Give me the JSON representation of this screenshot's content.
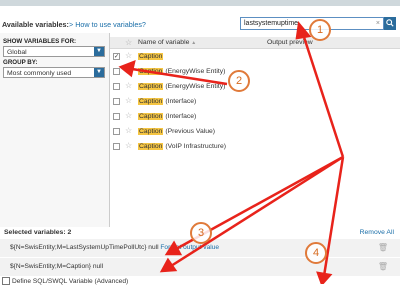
{
  "header": {
    "available_label": "Available variables:",
    "help_link": "> How to use variables?"
  },
  "search": {
    "value": "lastsystemuptime",
    "clear_glyph": "×",
    "button_icon": "search-icon"
  },
  "left_panel": {
    "show_for_label": "SHOW VARIABLES FOR:",
    "show_for_value": "Global",
    "group_by_label": "GROUP BY:",
    "group_by_value": "Most commonly used"
  },
  "table": {
    "col_name": "Name of variable",
    "col_name_sort": "▲",
    "col_preview": "Output preview",
    "rows": [
      {
        "highlight": "Caption",
        "rest": "",
        "checked": true
      },
      {
        "highlight": "Caption",
        "rest": " (EnergyWise Entity)",
        "checked": false
      },
      {
        "highlight": "Caption",
        "rest": " (EnergyWise Entity)",
        "checked": false
      },
      {
        "highlight": "Caption",
        "rest": " (Interface)",
        "checked": false
      },
      {
        "highlight": "Caption",
        "rest": " (Interface)",
        "checked": false
      },
      {
        "highlight": "Caption",
        "rest": " (Previous Value)",
        "checked": false
      },
      {
        "highlight": "Caption",
        "rest": " (VoIP Infrastructure)",
        "checked": false
      }
    ]
  },
  "selected": {
    "label": "Selected variables: 2",
    "remove_all": "Remove All",
    "items": [
      {
        "text": "${N=SwisEntity;M=LastSystemUpTimePollUtc}",
        "value": " null ",
        "format": "Format output value"
      },
      {
        "text": "${N=SwisEntity;M=Caption}",
        "value": " null",
        "format": ""
      }
    ]
  },
  "footer": {
    "define_sql": "Define SQL/SWQL Variable (Advanced)"
  },
  "annotations": {
    "color": "#e8231b",
    "badge_color": "#e07a3a",
    "badges": [
      "1",
      "2",
      "3",
      "4"
    ]
  }
}
